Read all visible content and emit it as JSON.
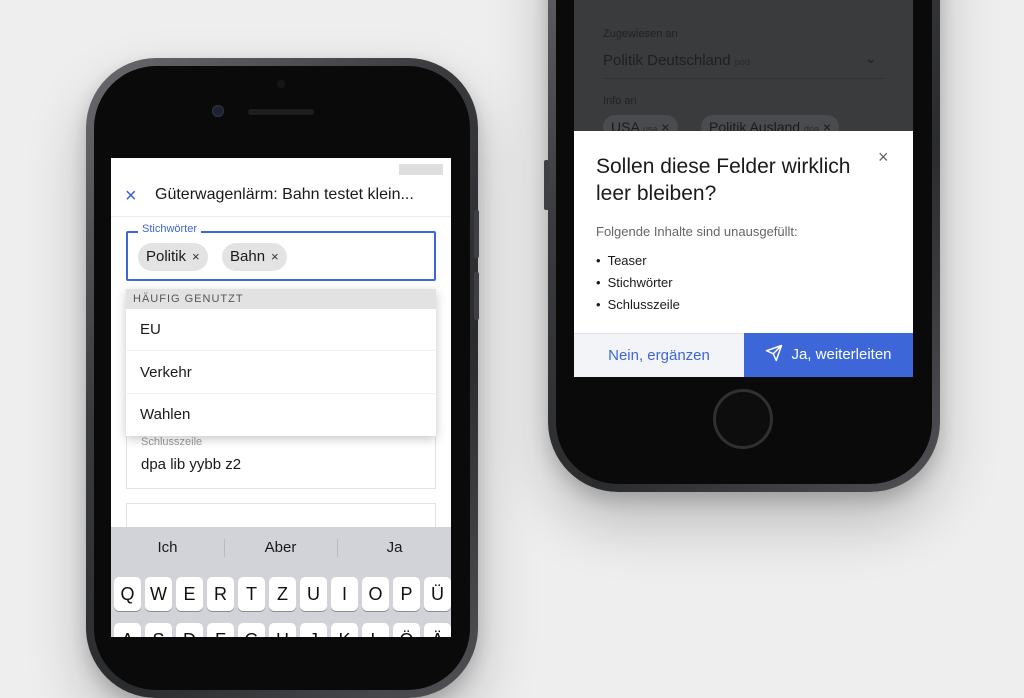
{
  "left_phone": {
    "header": {
      "close_icon": "×",
      "title": "Güterwagenlärm: Bahn testet klein..."
    },
    "tags_field": {
      "label": "Stichwörter",
      "chips": [
        {
          "label": "Politik"
        },
        {
          "label": "Bahn"
        }
      ],
      "chip_remove": "×"
    },
    "suggestions": {
      "header": "HÄUFIG GENUTZT",
      "items": [
        {
          "label": "EU"
        },
        {
          "label": "Verkehr"
        },
        {
          "label": "Wahlen"
        }
      ]
    },
    "schlusszeile": {
      "label": "Schlusszeile",
      "value": "dpa lib yybb z2"
    },
    "keyboard": {
      "suggestions": [
        "Ich",
        "Aber",
        "Ja"
      ],
      "row1": [
        "Q",
        "W",
        "E",
        "R",
        "T",
        "Z",
        "U",
        "I",
        "O",
        "P",
        "Ü"
      ],
      "row2": [
        "A",
        "S",
        "D",
        "F",
        "G",
        "H",
        "J",
        "K",
        "L",
        "Ö",
        "Ä"
      ]
    }
  },
  "right_phone": {
    "background": {
      "assigned_label": "Zugewiesen an",
      "assigned_value": "Politik Deutschland",
      "assigned_hint": "pod",
      "info_label": "Info an",
      "info_chips": [
        {
          "label": "USA",
          "hint": "usa"
        },
        {
          "label": "Politik Ausland",
          "hint": "dpa"
        }
      ]
    },
    "modal": {
      "title": "Sollen diese Felder wirklich leer bleiben?",
      "close_icon": "×",
      "description": "Folgende Inhalte sind unausgefüllt:",
      "items": [
        "Teaser",
        "Stichwörter",
        "Schlusszeile"
      ],
      "cancel_label": "Nein, ergänzen",
      "confirm_label": "Ja, weiterleiten",
      "confirm_icon": "send-icon"
    }
  },
  "colors": {
    "accent": "#3d67d8",
    "background": "#eeeeef"
  }
}
